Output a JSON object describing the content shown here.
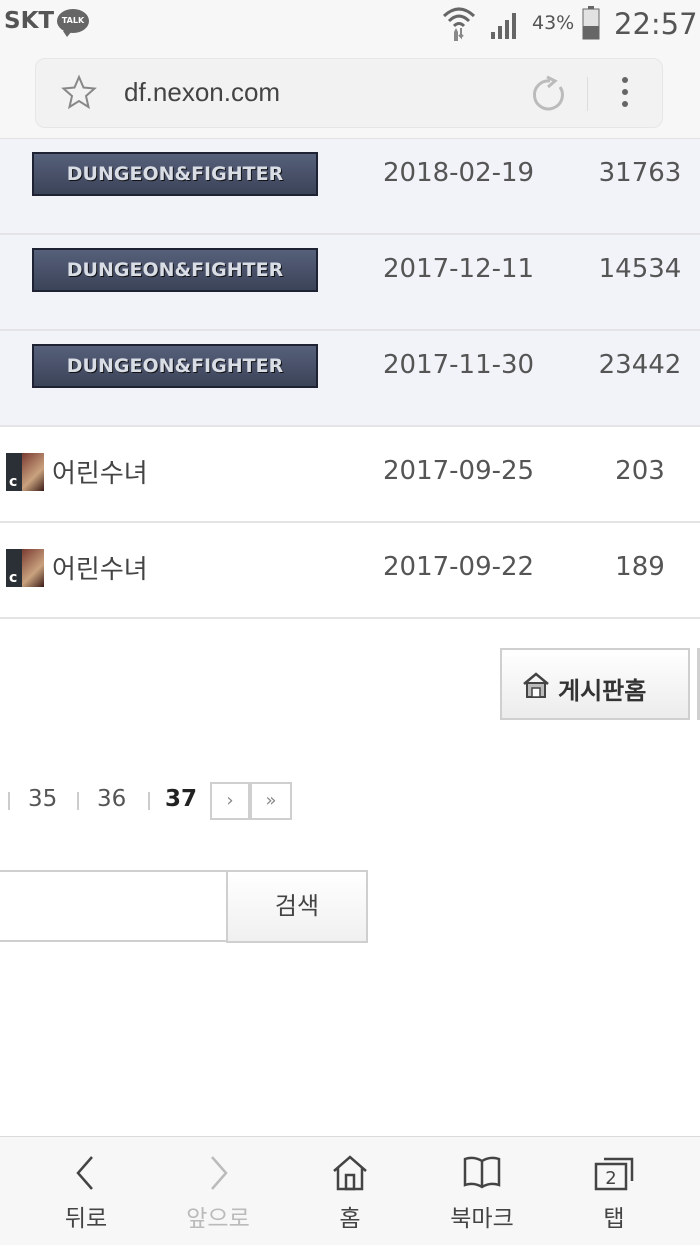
{
  "status_bar": {
    "carrier": "SKT",
    "talk_badge": "TALK",
    "battery_percent": "43%",
    "battery_level": 0.43,
    "time": "22:57"
  },
  "browser": {
    "url": "df.nexon.com",
    "icons": [
      "star-icon",
      "reload-icon",
      "more-vert-icon"
    ]
  },
  "posts": [
    {
      "type": "notice",
      "author_banner": "DUNGEON&FIGHTER",
      "date": "2018-02-19",
      "views": "31763"
    },
    {
      "type": "notice",
      "author_banner": "DUNGEON&FIGHTER",
      "date": "2017-12-11",
      "views": "14534"
    },
    {
      "type": "notice",
      "author_banner": "DUNGEON&FIGHTER",
      "date": "2017-11-30",
      "views": "23442"
    },
    {
      "type": "regular",
      "author": "어린수녀",
      "avatar_class": "c",
      "date": "2017-09-25",
      "views": "203"
    },
    {
      "type": "regular",
      "author": "어린수녀",
      "avatar_class": "c",
      "date": "2017-09-22",
      "views": "189"
    }
  ],
  "board_home_button": {
    "label": "게시판홈",
    "icon": "house-icon"
  },
  "pagination": {
    "pages": [
      "35",
      "36",
      "37"
    ],
    "current": "37",
    "next_label": "›",
    "last_label": "»"
  },
  "search": {
    "input_value": "",
    "button_label": "검색"
  },
  "bottom_nav": [
    {
      "label": "뒤로",
      "icon": "back-icon",
      "enabled": true
    },
    {
      "label": "앞으로",
      "icon": "forward-icon",
      "enabled": false
    },
    {
      "label": "홈",
      "icon": "home-icon",
      "enabled": true
    },
    {
      "label": "북마크",
      "icon": "bookmark-icon",
      "enabled": true
    },
    {
      "label": "탭",
      "icon": "tabs-icon",
      "enabled": true,
      "badge": "2"
    }
  ]
}
